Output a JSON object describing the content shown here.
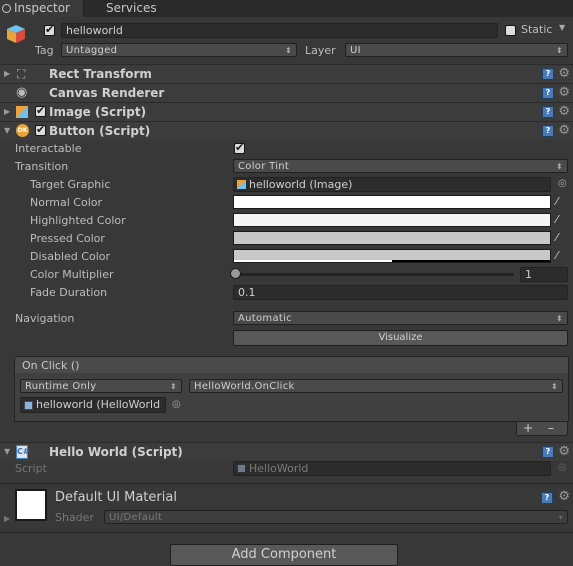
{
  "tabs": [
    {
      "label": "Inspector",
      "active": true
    },
    {
      "label": "Services",
      "active": false
    }
  ],
  "object": {
    "name": "helloworld",
    "static_label": "Static",
    "tag_label": "Tag",
    "tag_value": "Untagged",
    "layer_label": "Layer",
    "layer_value": "UI"
  },
  "components": [
    {
      "title": "Rect Transform",
      "icon": "rect-transform-icon"
    },
    {
      "title": "Canvas Renderer",
      "icon": "eye-icon"
    },
    {
      "title": "Image (Script)",
      "icon": "image-icon"
    },
    {
      "title": "Button (Script)",
      "icon": "button-ok-icon"
    }
  ],
  "button": {
    "interactable_label": "Interactable",
    "transition_label": "Transition",
    "transition_value": "Color Tint",
    "target_graphic_label": "Target Graphic",
    "target_graphic_value": "helloworld (Image)",
    "normal_color_label": "Normal Color",
    "highlighted_color_label": "Highlighted Color",
    "pressed_color_label": "Pressed Color",
    "disabled_color_label": "Disabled Color",
    "color_multiplier_label": "Color Multiplier",
    "color_multiplier_value": "1",
    "fade_duration_label": "Fade Duration",
    "fade_duration_value": "0.1",
    "navigation_label": "Navigation",
    "navigation_value": "Automatic",
    "visualize_label": "Visualize"
  },
  "onclick": {
    "header": "On Click ()",
    "runtime_value": "Runtime Only",
    "function_value": "HelloWorld.OnClick",
    "object_value": "helloworld (HelloWorld",
    "add_label": "+",
    "remove_label": "–"
  },
  "hello_world": {
    "title": "Hello World (Script)",
    "script_label": "Script",
    "script_value": "HelloWorld"
  },
  "material": {
    "name": "Default UI Material",
    "shader_label": "Shader",
    "shader_value": "UI/Default"
  },
  "add_component_label": "Add Component",
  "colors": {
    "normal": "#ffffff",
    "highlighted": "#f5f5f5",
    "pressed": "#c8c8c8",
    "disabled": "#c8c8c8",
    "background": "#383838"
  }
}
